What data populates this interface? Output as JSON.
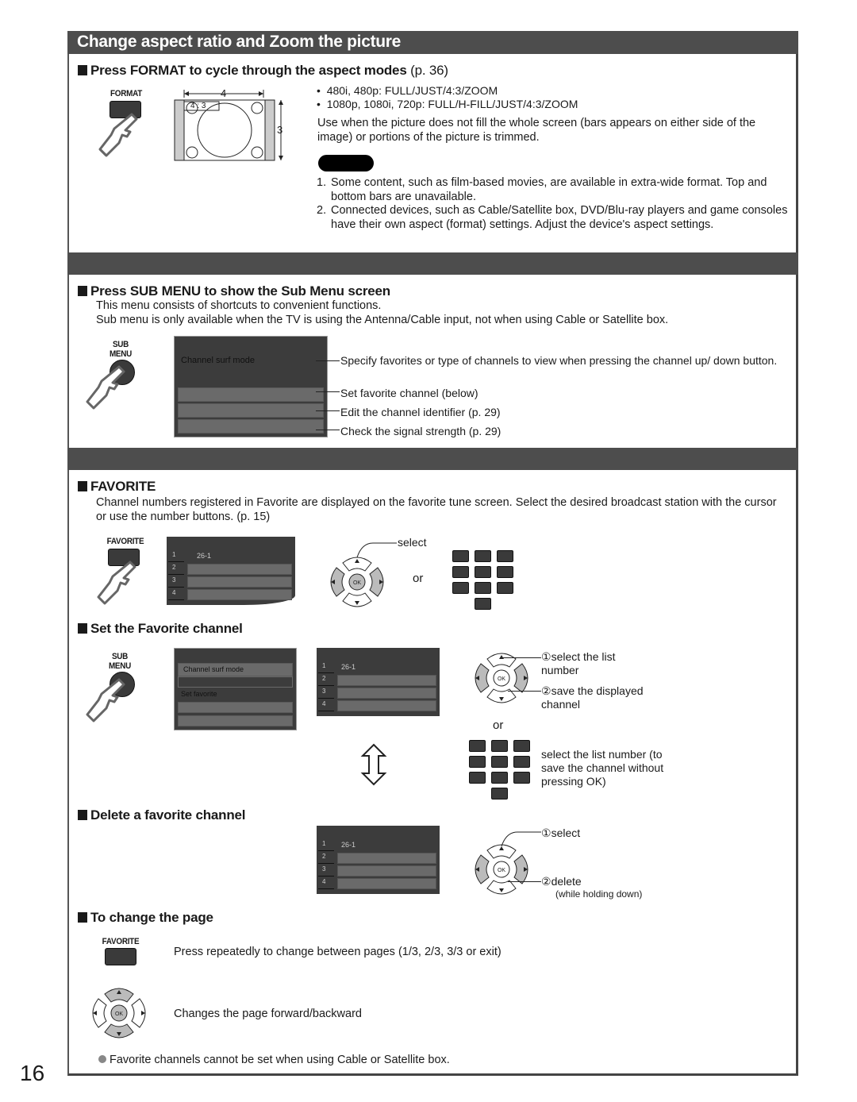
{
  "page_number": "16",
  "section1": {
    "title": "Change aspect ratio and Zoom the picture",
    "heading": "Press FORMAT to cycle through the aspect modes",
    "heading_ref": "(p. 36)",
    "button_label": "FORMAT",
    "diagram": {
      "width_label": "4",
      "height_label": "3",
      "ratio_label": "4 : 3"
    },
    "modes": [
      "480i, 480p:  FULL/JUST/4:3/ZOOM",
      "1080p, 1080i, 720p:  FULL/H-FILL/JUST/4:3/ZOOM"
    ],
    "description": "Use when the picture does not fill the whole screen (bars appears on either side of the image) or portions of the picture is trimmed.",
    "notes": [
      {
        "num": "1.",
        "text": "Some content, such as film-based movies, are available in extra-wide format. Top and bottom bars are unavailable."
      },
      {
        "num": "2.",
        "text": "Connected devices, such as Cable/Satellite box, DVD/Blu-ray players and game consoles have their own aspect (format) settings. Adjust the device's aspect settings."
      }
    ]
  },
  "section2": {
    "heading": "Press SUB MENU to show the Sub Menu screen",
    "intro": [
      "This menu consists of shortcuts to convenient functions.",
      "Sub menu is only available when the TV is using the Antenna/Cable input, not when using Cable or Satellite box."
    ],
    "button_label_1": "SUB",
    "button_label_2": "MENU",
    "menu_items": [
      "Channel surf mode"
    ],
    "callouts": [
      "Specify favorites or type of channels to view when pressing the channel up/ down button.",
      "Set favorite channel (below)",
      "Edit the channel identifier (p. 29)",
      "Check the signal strength (p. 29)"
    ]
  },
  "section3": {
    "favorite": {
      "heading": "FAVORITE",
      "description": "Channel numbers registered in Favorite are displayed on the favorite tune screen. Select the desired broadcast station with the cursor or use the number buttons. (p. 15)",
      "button_label": "FAVORITE",
      "list": [
        {
          "num": "1",
          "channel": "26-1"
        },
        {
          "num": "2",
          "channel": ""
        },
        {
          "num": "3",
          "channel": ""
        },
        {
          "num": "4",
          "channel": ""
        }
      ],
      "select_label": "select",
      "or_label": "or",
      "ok_label": "OK"
    },
    "set_favorite": {
      "heading": "Set the Favorite channel",
      "button_label_1": "SUB",
      "button_label_2": "MENU",
      "menu_items": [
        "Channel surf mode",
        "Set favorite"
      ],
      "list": [
        {
          "num": "1",
          "channel": "26-1"
        },
        {
          "num": "2",
          "channel": ""
        },
        {
          "num": "3",
          "channel": ""
        },
        {
          "num": "4",
          "channel": ""
        }
      ],
      "step1_marker": "①",
      "step1": "select the list number",
      "step2_marker": "②",
      "step2": "save the displayed channel",
      "or_label": "or",
      "keypad_note": "select the list number (to save the channel without pressing OK)"
    },
    "delete_favorite": {
      "heading": "Delete a favorite channel",
      "list": [
        {
          "num": "1",
          "channel": "26-1"
        },
        {
          "num": "2",
          "channel": ""
        },
        {
          "num": "3",
          "channel": ""
        },
        {
          "num": "4",
          "channel": ""
        }
      ],
      "step1_marker": "①",
      "step1": "select",
      "step2_marker": "②",
      "step2": "delete",
      "step2_sub": "(while holding down)"
    },
    "change_page": {
      "heading": "To change the page",
      "button_label": "FAVORITE",
      "favorite_desc": "Press repeatedly to change between pages (1/3, 2/3, 3/3 or exit)",
      "arrows_desc": "Changes the page forward/backward",
      "note": "Favorite channels cannot be set when using Cable or Satellite box."
    }
  }
}
